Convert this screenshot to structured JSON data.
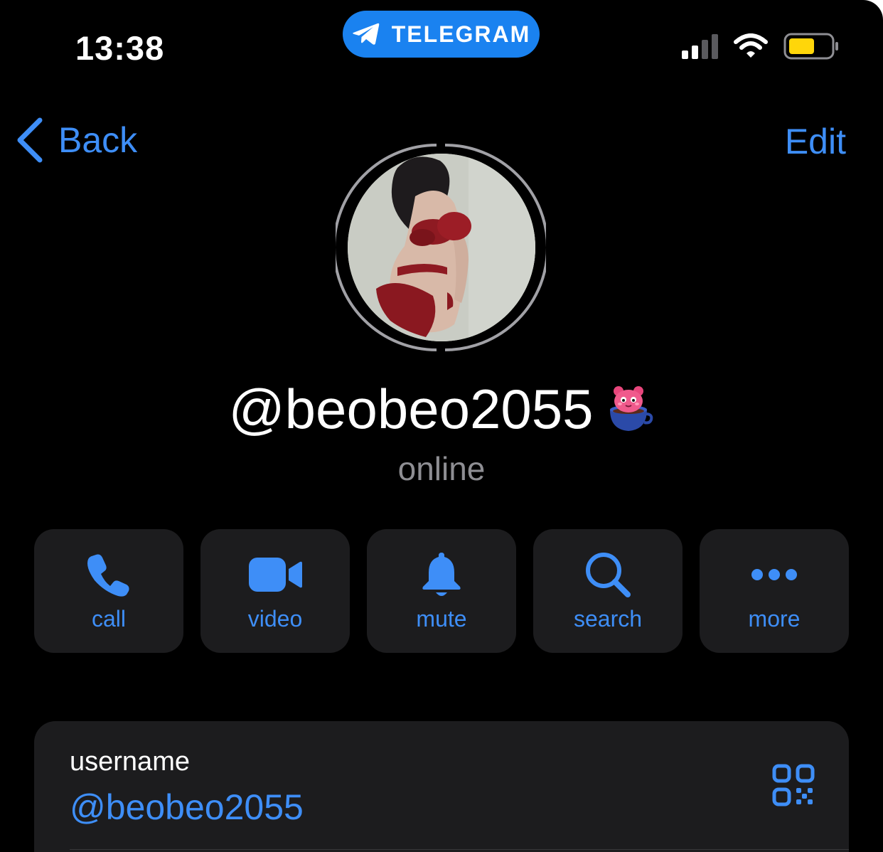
{
  "status_bar": {
    "time": "13:38",
    "app_pill": "TELEGRAM",
    "signal_icon": "cellular-signal-icon",
    "wifi_icon": "wifi-icon",
    "battery_icon": "battery-icon",
    "battery_color": "#ffd60a"
  },
  "nav": {
    "back_label": "Back",
    "edit_label": "Edit"
  },
  "profile": {
    "display_name": "@beobeo2055",
    "status": "online",
    "emoji_status_icon": "bear-in-cup-emoji-icon"
  },
  "actions": [
    {
      "label": "call",
      "icon": "phone-icon"
    },
    {
      "label": "video",
      "icon": "video-camera-icon"
    },
    {
      "label": "mute",
      "icon": "bell-icon"
    },
    {
      "label": "search",
      "icon": "search-icon"
    },
    {
      "label": "more",
      "icon": "more-dots-icon"
    }
  ],
  "info": {
    "username_label": "username",
    "username_value": "@beobeo2055",
    "qr_icon": "qr-code-icon"
  },
  "colors": {
    "accent": "#3e8ef7",
    "background": "#000000",
    "card": "#1c1c1e",
    "secondary_text": "#8e8e93",
    "telegram_blue": "#1a82f0"
  }
}
